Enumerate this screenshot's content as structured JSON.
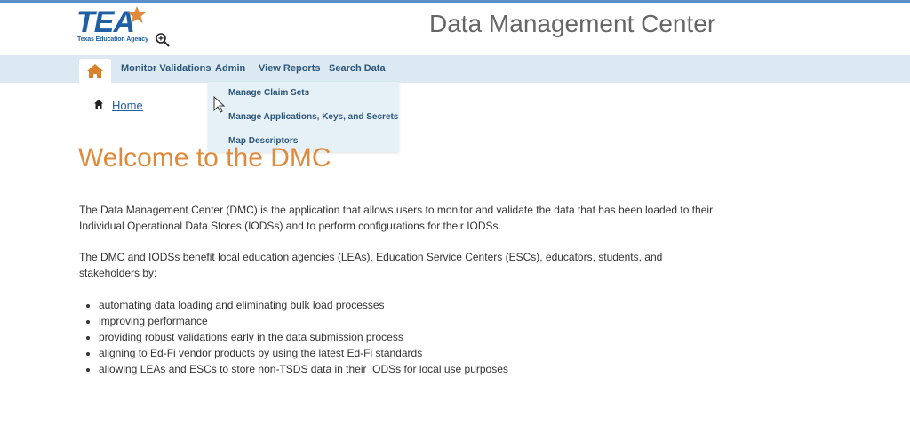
{
  "header": {
    "logo_letters": "TEA",
    "logo_subtext": "Texas Education Agency",
    "app_title": "Data Management Center"
  },
  "nav": {
    "items": [
      {
        "label": "Monitor Validations"
      },
      {
        "label": "Admin"
      },
      {
        "label": "View Reports"
      },
      {
        "label": "Search Data"
      }
    ],
    "admin_dropdown": [
      {
        "label": "Manage Claim Sets"
      },
      {
        "label": "Manage Applications, Keys, and Secrets"
      },
      {
        "label": "Map Descriptors"
      }
    ]
  },
  "breadcrumb": {
    "home": "Home"
  },
  "main": {
    "heading": "Welcome to the DMC",
    "para1": "The Data Management Center (DMC) is the application that allows users to monitor and validate the data that has been loaded to their Individual Operational Data Stores (IODSs) and to perform configurations for their IODSs.",
    "para2": "The DMC and IODSs benefit local education agencies (LEAs), Education Service Centers (ESCs), educators, students, and stakeholders by:",
    "bullets": [
      "automating data loading and eliminating bulk load processes",
      "improving performance",
      "providing robust validations early in the data submission process",
      "aligning to Ed-Fi vendor products by using the latest Ed-Fi standards",
      "allowing LEAs and ESCs to store non-TSDS data in their IODSs for local use purposes"
    ]
  },
  "colors": {
    "brand_blue": "#1f5fa6",
    "nav_bg": "#dbeaf2",
    "heading_orange": "#e08a3c",
    "home_icon": "#d9822b"
  },
  "icons": [
    "home-icon",
    "magnifier-zoom-icon",
    "mouse-cursor-icon",
    "star-icon"
  ]
}
